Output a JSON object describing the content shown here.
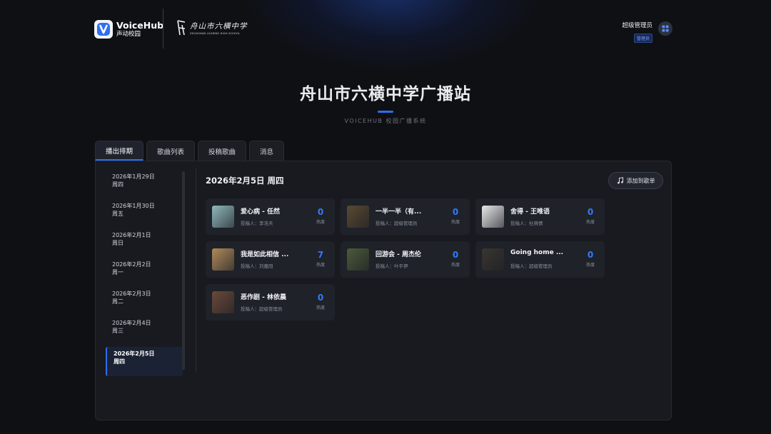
{
  "brand": {
    "name": "VoiceHub",
    "sub": "声动校园"
  },
  "school": {
    "name_cn": "舟山市六横中学",
    "name_en": "ZHOUSHAN LIUHENG HIGH SCHOOL"
  },
  "user": {
    "name": "超级管理员",
    "role": "管理员"
  },
  "header": {
    "title": "舟山市六横中学广播站",
    "subtitle": "VOICEHUB 校园广播系统"
  },
  "tabs": [
    {
      "label": "播出排期"
    },
    {
      "label": "歌曲列表"
    },
    {
      "label": "投稿歌曲"
    },
    {
      "label": "消息"
    }
  ],
  "dates": [
    {
      "date": "2026年1月29日",
      "weekday": "周四"
    },
    {
      "date": "2026年1月30日",
      "weekday": "周五"
    },
    {
      "date": "2026年2月1日",
      "weekday": "周日"
    },
    {
      "date": "2026年2月2日",
      "weekday": "周一"
    },
    {
      "date": "2026年2月3日",
      "weekday": "周二"
    },
    {
      "date": "2026年2月4日",
      "weekday": "周三"
    },
    {
      "date": "2026年2月5日",
      "weekday": "周四"
    }
  ],
  "schedule": {
    "title": "2026年2月5日 周四",
    "add_label": "添加到歌单"
  },
  "songs": [
    {
      "title": "爱心病 - 任然",
      "submitter": "投稿人：李浩天",
      "votes": "0",
      "vote_label": "热度",
      "cover": "#8fb8bb"
    },
    {
      "title": "一半一半（有...",
      "submitter": "投稿人：超级管理员",
      "votes": "0",
      "vote_label": "热度",
      "cover": "#5a4a32"
    },
    {
      "title": "舍得 - 王唯语",
      "submitter": "投稿人：杜晓倩",
      "votes": "0",
      "vote_label": "热度",
      "cover": "#e8e8e8"
    },
    {
      "title": "我是如此相信 ...",
      "submitter": "投稿人：刘嘉阳",
      "votes": "7",
      "vote_label": "热度",
      "cover": "#b08a5a"
    },
    {
      "title": "回游会 - 周杰伦",
      "submitter": "投稿人：叶平伊",
      "votes": "0",
      "vote_label": "热度",
      "cover": "#4b5a3a"
    },
    {
      "title": "Going home ...",
      "submitter": "投稿人：超级管理员",
      "votes": "0",
      "vote_label": "热度",
      "cover": "#3a3630"
    },
    {
      "title": "恶作剧 - 林依晨",
      "submitter": "投稿人：超级管理员",
      "votes": "0",
      "vote_label": "热度",
      "cover": "#6a4a3a"
    }
  ]
}
